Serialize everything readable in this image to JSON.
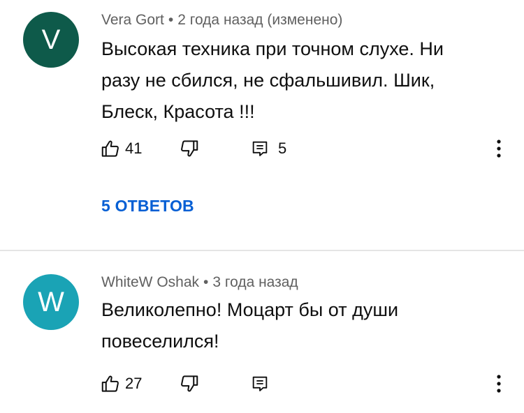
{
  "colors": {
    "avatar_vera": "#0e5a4a",
    "avatar_whitew": "#1aa3b5",
    "link": "#065fd4",
    "meta_text": "#606060"
  },
  "comments": [
    {
      "avatar_letter": "V",
      "author": "Vera Gort",
      "separator": "•",
      "time": "2 года назад (изменено)",
      "text": "Высокая техника при точном слухе. Ни разу не сбился, не сфальшивил. Шик, Блеск, Красота !!!",
      "likes": "41",
      "replies_count": "5",
      "replies_link": "5 ОТВЕТОВ",
      "icons": {
        "like": "thumbs-up-icon",
        "dislike": "thumbs-down-icon",
        "reply": "reply-icon",
        "menu": "more-vert-icon"
      }
    },
    {
      "avatar_letter": "W",
      "author": "WhiteW Oshak",
      "separator": "•",
      "time": "3 года назад",
      "text": "Великолепно! Моцарт бы от души повеселился!",
      "likes": "27",
      "icons": {
        "like": "thumbs-up-icon",
        "dislike": "thumbs-down-icon",
        "reply": "reply-icon",
        "menu": "more-vert-icon"
      }
    }
  ]
}
